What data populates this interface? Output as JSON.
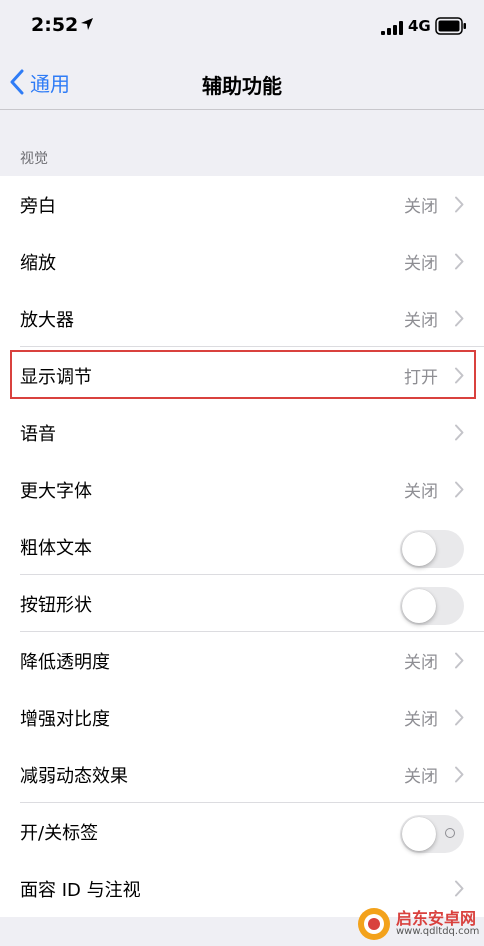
{
  "status_bar": {
    "time": "2:52",
    "network": "4G"
  },
  "nav": {
    "back_label": "通用",
    "title": "辅助功能"
  },
  "section_header": "视觉",
  "rows": [
    {
      "label": "旁白",
      "value": "关闭",
      "type": "chevron"
    },
    {
      "label": "缩放",
      "value": "关闭",
      "type": "chevron"
    },
    {
      "label": "放大器",
      "value": "关闭",
      "type": "chevron"
    },
    {
      "label": "显示调节",
      "value": "打开",
      "type": "chevron"
    },
    {
      "label": "语音",
      "value": "",
      "type": "chevron"
    },
    {
      "label": "更大字体",
      "value": "关闭",
      "type": "chevron"
    },
    {
      "label": "粗体文本",
      "type": "toggle",
      "on": false
    },
    {
      "label": "按钮形状",
      "type": "toggle",
      "on": false
    },
    {
      "label": "降低透明度",
      "value": "关闭",
      "type": "chevron"
    },
    {
      "label": "增强对比度",
      "value": "关闭",
      "type": "chevron"
    },
    {
      "label": "减弱动态效果",
      "value": "关闭",
      "type": "chevron"
    },
    {
      "label": "开/关标签",
      "type": "toggle",
      "on": false
    },
    {
      "label": "面容 ID 与注视",
      "value": "",
      "type": "chevron"
    }
  ],
  "watermark": {
    "title": "启东安卓网",
    "url": "www.qdltdq.com"
  },
  "colors": {
    "accent": "#2f7cf6",
    "highlight": "#d9413e",
    "background": "#efeff4"
  }
}
